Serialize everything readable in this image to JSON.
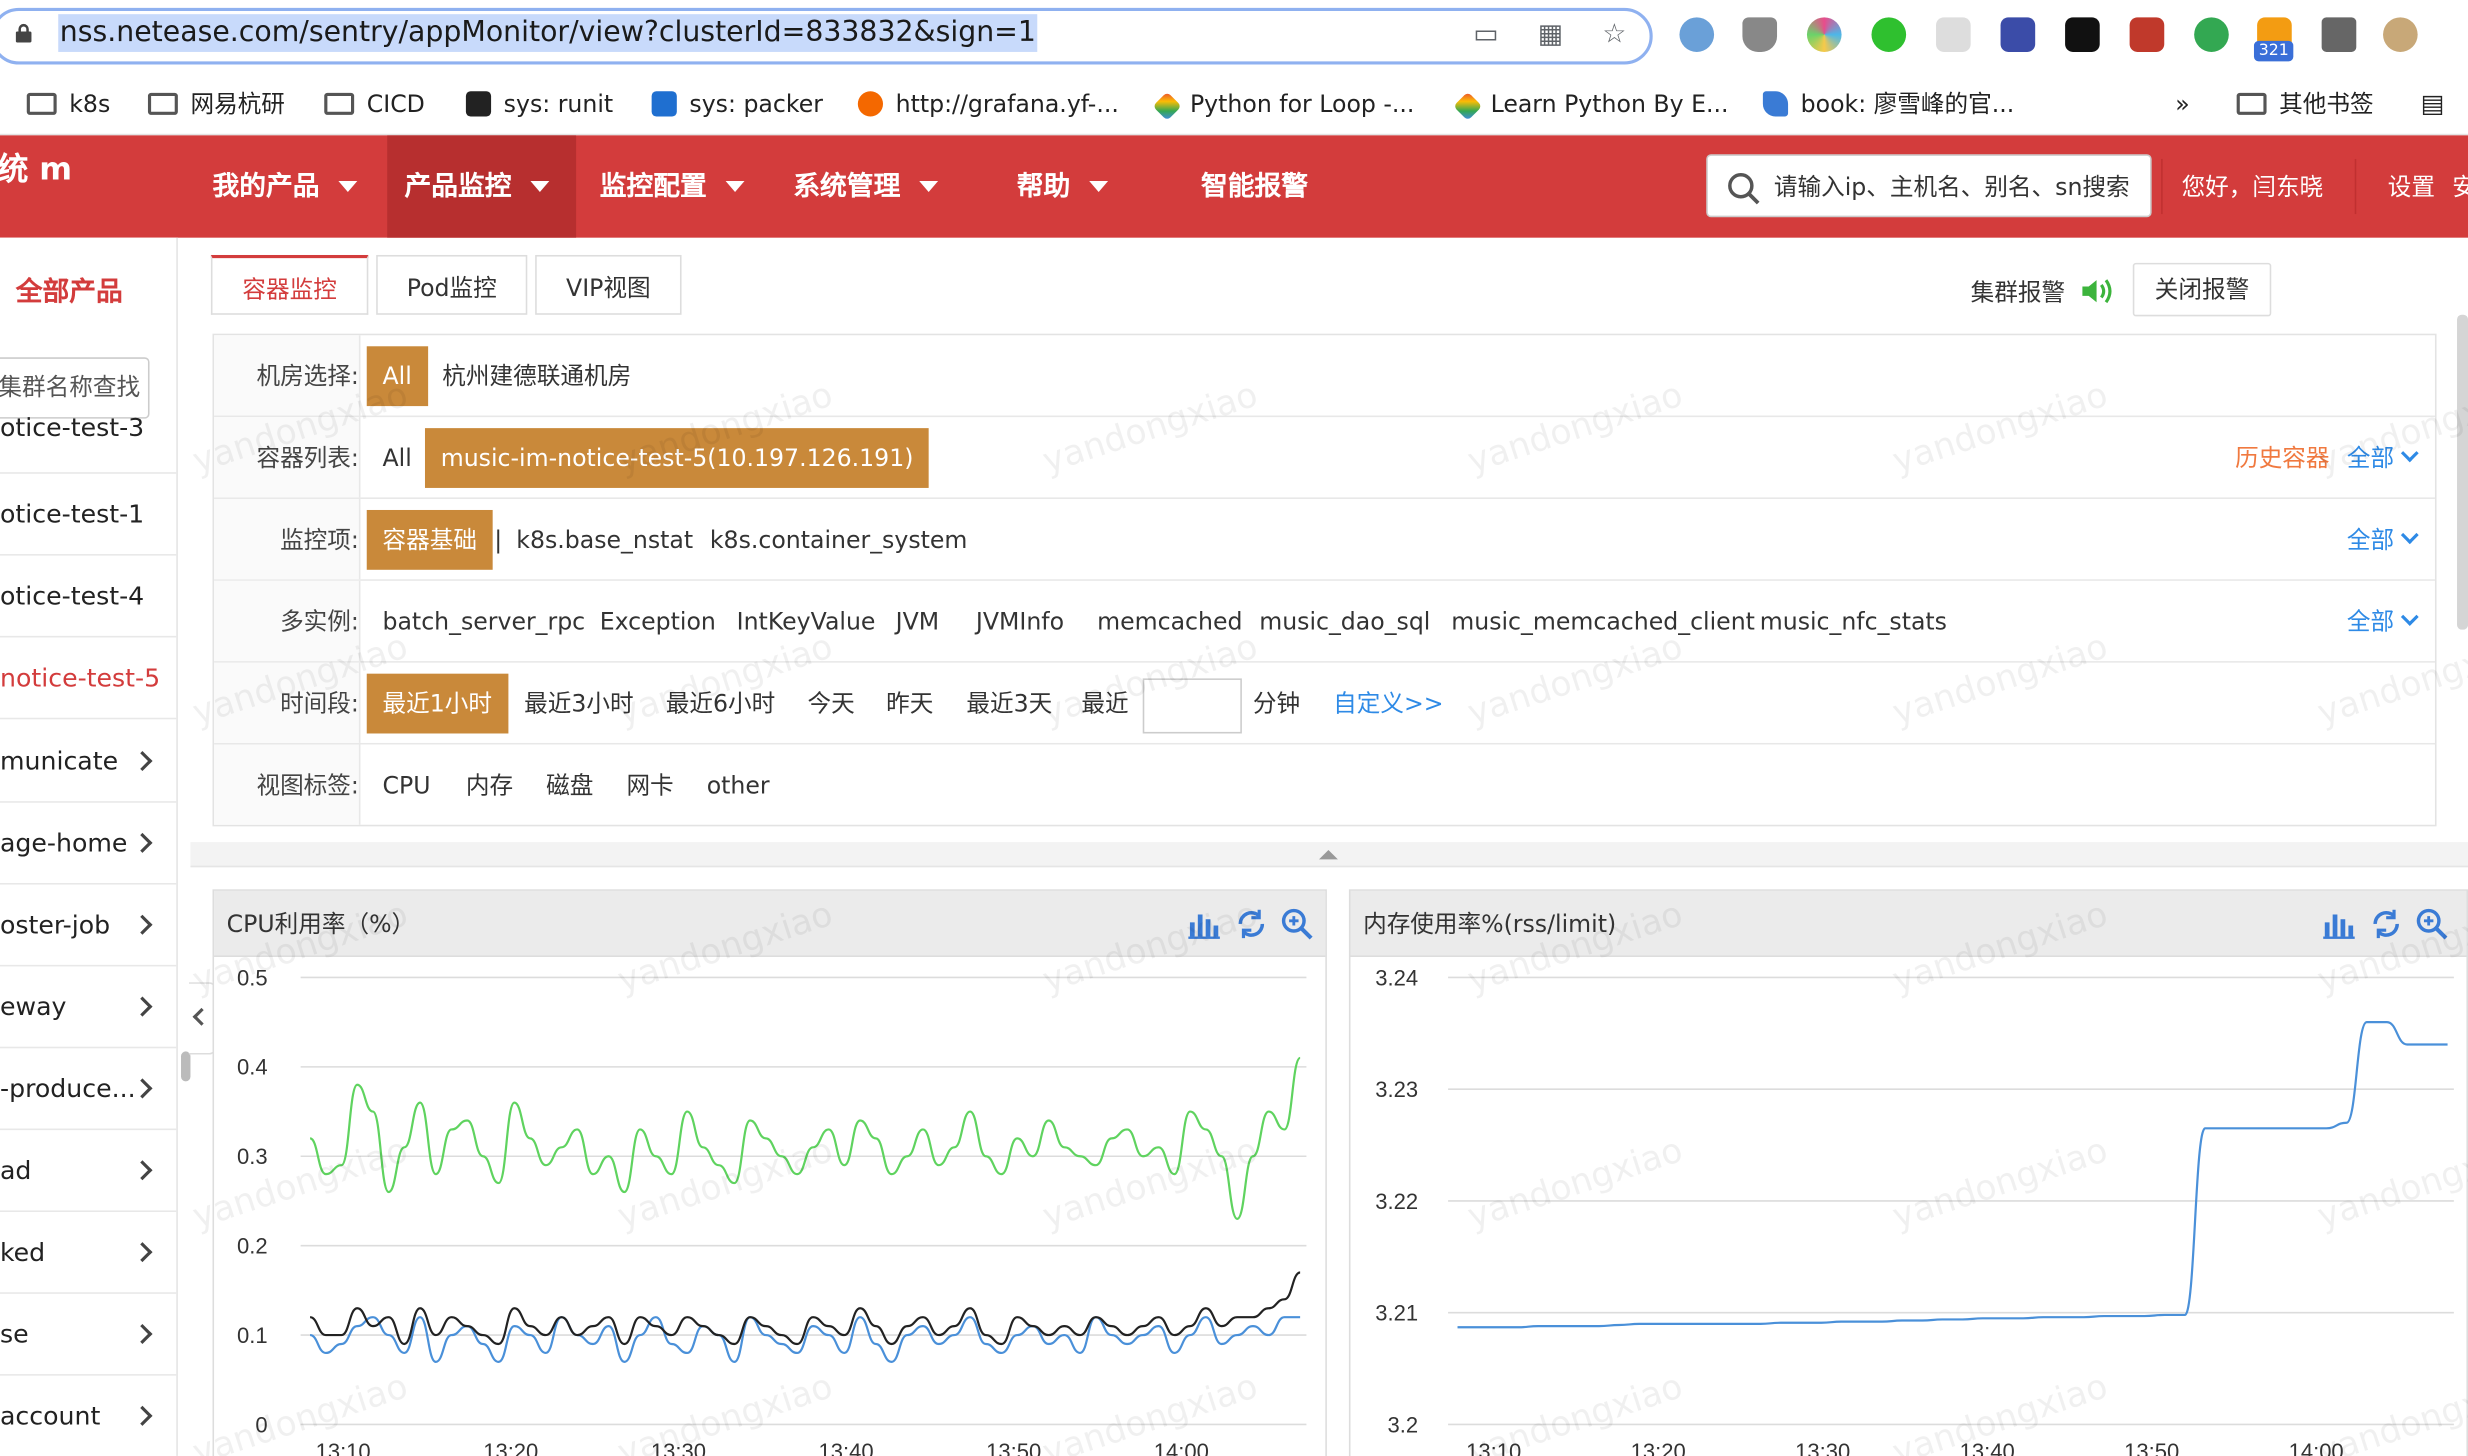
{
  "browser": {
    "url": "nss.netease.com/sentry/appMonitor/view?clusterId=833832&sign=1",
    "ext_badge": "321"
  },
  "bookmarks": [
    {
      "label": "k8s",
      "icon": "folder-icon"
    },
    {
      "label": "网易杭研",
      "icon": "folder-icon"
    },
    {
      "label": "CICD",
      "icon": "folder-icon"
    },
    {
      "label": "sys: runit",
      "icon": "runit-icon"
    },
    {
      "label": "sys: packer",
      "icon": "packer-icon"
    },
    {
      "label": "http://grafana.yf-...",
      "icon": "grafana-icon"
    },
    {
      "label": "Python for Loop -...",
      "icon": "diamond-icon"
    },
    {
      "label": "Learn Python By E...",
      "icon": "diamond-icon"
    },
    {
      "label": "book: 廖雪峰的官...",
      "icon": "rocket-icon"
    },
    {
      "label": "»",
      "icon": ""
    },
    {
      "label": "其他书签",
      "icon": "folder-icon"
    }
  ],
  "nav": {
    "logo": "统 m",
    "menu": [
      "我的产品",
      "产品监控",
      "监控配置",
      "系统管理",
      "帮助",
      "智能报警"
    ],
    "search_placeholder": "请输入ip、主机名、别名、sn搜索",
    "greeting": "您好，闫东晓",
    "settings": "设置",
    "trailing": "安"
  },
  "sidebar": {
    "title": "全部产品",
    "search_text": "集群名称查找",
    "items": [
      {
        "label": "otice-test-3"
      },
      {
        "label": "otice-test-1"
      },
      {
        "label": "otice-test-4"
      },
      {
        "label": "notice-test-5"
      },
      {
        "label": "municate"
      },
      {
        "label": "age-home"
      },
      {
        "label": "oster-job"
      },
      {
        "label": "eway"
      },
      {
        "label": "-produce..."
      },
      {
        "label": "ad"
      },
      {
        "label": "ked"
      },
      {
        "label": "se"
      },
      {
        "label": "account"
      }
    ]
  },
  "tabs": [
    "容器监控",
    "Pod监控",
    "VIP视图"
  ],
  "alarm": {
    "label": "集群报警",
    "close": "关闭报警"
  },
  "filters": {
    "room": {
      "label": "机房选择:",
      "options": [
        "All",
        "杭州建德联通机房"
      ]
    },
    "containers": {
      "label": "容器列表:",
      "options": [
        "All",
        "music-im-notice-test-5(10.197.126.191)"
      ],
      "history": "历史容器",
      "all": "全部"
    },
    "items": {
      "label": "监控项:",
      "options": [
        "容器基础",
        "k8s.base_nstat",
        "k8s.container_system"
      ],
      "sep": "|",
      "all": "全部"
    },
    "multi": {
      "label": "多实例:",
      "options": [
        "batch_server_rpc",
        "Exception",
        "IntKeyValue",
        "JVM",
        "JVMInfo",
        "memcached",
        "music_dao_sql",
        "music_memcached_client",
        "music_nfc_stats"
      ],
      "all": "全部"
    },
    "time": {
      "label": "时间段:",
      "options": [
        "最近1小时",
        "最近3小时",
        "最近6小时",
        "今天",
        "昨天",
        "最近3天",
        "最近"
      ],
      "unit": "分钟",
      "custom": "自定义>>"
    },
    "tags": {
      "label": "视图标签:",
      "options": [
        "CPU",
        "内存",
        "磁盘",
        "网卡",
        "other"
      ]
    }
  },
  "watermark": "yandongxiao",
  "colors": {
    "brand": "#d33c3c",
    "selected": "#c9893a",
    "link": "#2e8ae6",
    "history": "#f0793f",
    "green": "#5fd35f",
    "blue": "#4a90d9",
    "black": "#222222"
  },
  "chart_data": [
    {
      "type": "line",
      "title": "CPU利用率（%）",
      "ylim": [
        0,
        0.5
      ],
      "yticks": [
        "0",
        "0.1",
        "0.2",
        "0.3",
        "0.4",
        "0.5"
      ],
      "xticks": [
        "13:10",
        "13:20",
        "13:30",
        "13:40",
        "13:50",
        "14:00"
      ],
      "series": [
        {
          "color": "green",
          "values": [
            0.32,
            0.28,
            0.29,
            0.38,
            0.35,
            0.26,
            0.31,
            0.36,
            0.28,
            0.33,
            0.34,
            0.3,
            0.27,
            0.36,
            0.32,
            0.29,
            0.31,
            0.33,
            0.28,
            0.3,
            0.26,
            0.33,
            0.3,
            0.28,
            0.35,
            0.31,
            0.29,
            0.27,
            0.34,
            0.32,
            0.3,
            0.28,
            0.31,
            0.33,
            0.29,
            0.34,
            0.32,
            0.28,
            0.3,
            0.33,
            0.29,
            0.31,
            0.35,
            0.3,
            0.28,
            0.32,
            0.3,
            0.34,
            0.31,
            0.3,
            0.29,
            0.32,
            0.33,
            0.3,
            0.31,
            0.28,
            0.35,
            0.33,
            0.3,
            0.23,
            0.3,
            0.35,
            0.33,
            0.41
          ]
        },
        {
          "color": "blue",
          "values": [
            0.1,
            0.08,
            0.09,
            0.11,
            0.12,
            0.1,
            0.08,
            0.12,
            0.07,
            0.1,
            0.11,
            0.09,
            0.07,
            0.11,
            0.1,
            0.08,
            0.12,
            0.1,
            0.09,
            0.11,
            0.07,
            0.1,
            0.12,
            0.09,
            0.08,
            0.11,
            0.1,
            0.07,
            0.12,
            0.1,
            0.09,
            0.08,
            0.11,
            0.1,
            0.08,
            0.12,
            0.09,
            0.07,
            0.1,
            0.11,
            0.09,
            0.1,
            0.12,
            0.09,
            0.08,
            0.1,
            0.11,
            0.09,
            0.1,
            0.08,
            0.12,
            0.1,
            0.09,
            0.1,
            0.11,
            0.08,
            0.1,
            0.12,
            0.09,
            0.1,
            0.11,
            0.1,
            0.12,
            0.12
          ]
        },
        {
          "color": "black",
          "values": [
            0.12,
            0.1,
            0.1,
            0.13,
            0.11,
            0.12,
            0.09,
            0.13,
            0.1,
            0.12,
            0.11,
            0.1,
            0.09,
            0.13,
            0.11,
            0.1,
            0.12,
            0.1,
            0.11,
            0.12,
            0.09,
            0.12,
            0.11,
            0.1,
            0.12,
            0.11,
            0.1,
            0.09,
            0.12,
            0.11,
            0.1,
            0.09,
            0.12,
            0.11,
            0.1,
            0.13,
            0.11,
            0.09,
            0.11,
            0.12,
            0.1,
            0.11,
            0.13,
            0.1,
            0.09,
            0.12,
            0.11,
            0.1,
            0.11,
            0.1,
            0.12,
            0.11,
            0.1,
            0.11,
            0.12,
            0.1,
            0.11,
            0.13,
            0.11,
            0.12,
            0.12,
            0.13,
            0.14,
            0.17
          ]
        }
      ]
    },
    {
      "type": "line",
      "title": "内存使用率%(rss/limit)",
      "ylim": [
        3.2,
        3.24
      ],
      "yticks": [
        "3.2",
        "3.21",
        "3.22",
        "3.23",
        "3.24"
      ],
      "xticks": [
        "13:10",
        "13:20",
        "13:30",
        "13:40",
        "13:50",
        "14:00"
      ],
      "series": [
        {
          "color": "blue",
          "values": [
            3.2087,
            3.2087,
            3.2087,
            3.2087,
            3.2088,
            3.2088,
            3.2088,
            3.2088,
            3.2089,
            3.209,
            3.209,
            3.209,
            3.209,
            3.209,
            3.209,
            3.209,
            3.2091,
            3.2091,
            3.2091,
            3.2092,
            3.2092,
            3.2092,
            3.2093,
            3.2093,
            3.2094,
            3.2094,
            3.2095,
            3.2095,
            3.2095,
            3.2096,
            3.2096,
            3.2096,
            3.2097,
            3.2097,
            3.2097,
            3.2098,
            3.2098,
            3.2265,
            3.2265,
            3.2265,
            3.2265,
            3.2265,
            3.2265,
            3.2265,
            3.227,
            3.236,
            3.236,
            3.234,
            3.234,
            3.234
          ]
        }
      ]
    }
  ]
}
